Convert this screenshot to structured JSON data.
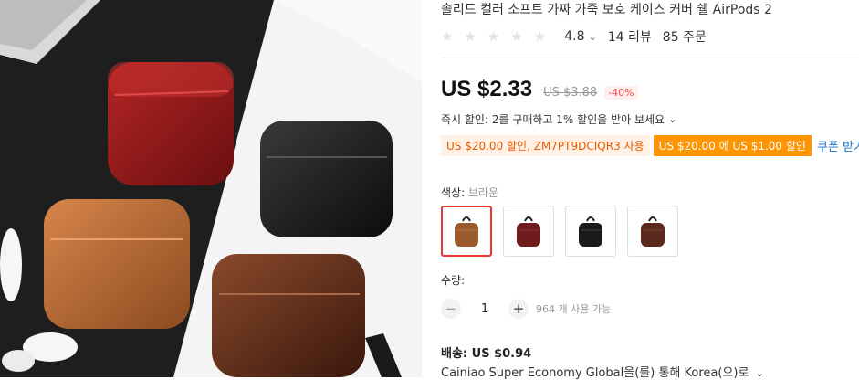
{
  "product": {
    "title": "솔리드 컬러 소프트 가짜 가죽 보호 케이스 커버 쉘 AirPods 2",
    "rating": "4.8",
    "reviews": "14 리뷰",
    "orders": "85 주문",
    "stars_filled": 0
  },
  "price": {
    "current": "US $2.33",
    "original": "US $3.88",
    "discount": "-40%"
  },
  "promo": {
    "instant_discount": "즉시 할인: 2를 구매하고 1% 할인을 받아 보세요",
    "coupon_code": "US $20.00 할인, ZM7PT9DCIQR3 사용",
    "coupon_store": "US $20.00 에 US $1.00 할인",
    "get_coupon": "쿠폰 받기"
  },
  "color": {
    "label": "색상:",
    "selected": "브라운",
    "options": [
      "brown",
      "wine-red",
      "black",
      "dark-brown"
    ],
    "swatch_colors": [
      "#9a5a2b",
      "#6e1c1c",
      "#1a1a1a",
      "#5a2a1e"
    ]
  },
  "quantity": {
    "label": "수량:",
    "value": "1",
    "available": "964 개 사용 가능"
  },
  "shipping": {
    "title": "배송: US $0.94",
    "method": "Cainiao Super Economy Global을(를) 통해 Korea(으)로"
  }
}
